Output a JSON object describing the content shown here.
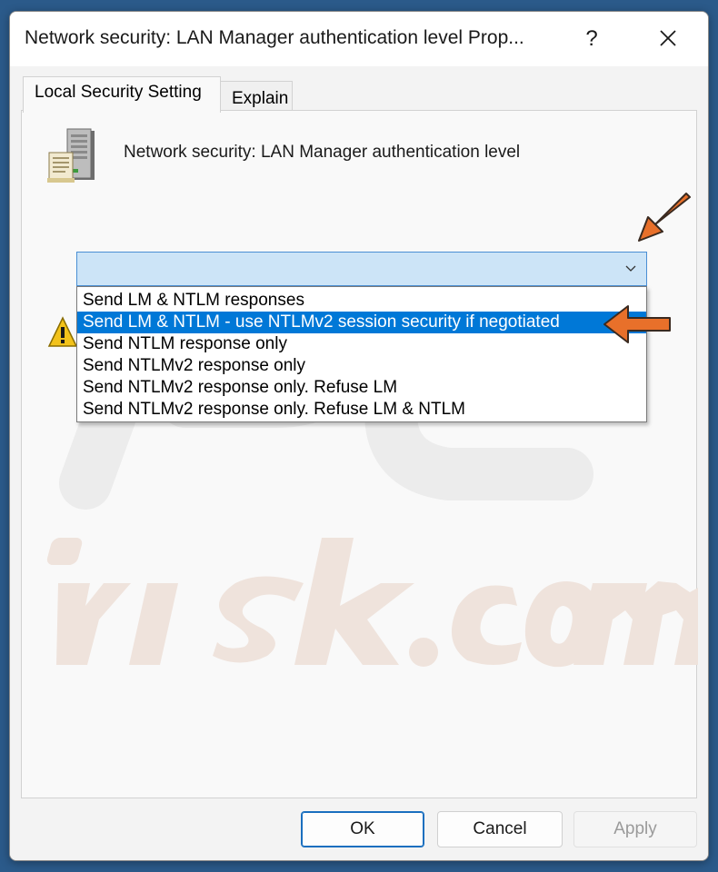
{
  "window": {
    "title": "Network security: LAN Manager authentication level Prop...",
    "help_label": "?",
    "close_icon": "close-icon"
  },
  "tabs": [
    {
      "label": "Local Security Setting",
      "active": true
    },
    {
      "label": "Explain",
      "active": false
    }
  ],
  "policy": {
    "name": "Network security: LAN Manager authentication level",
    "icon": "server-icon"
  },
  "combo": {
    "value": "",
    "icon": "chevron-down-icon",
    "options": [
      "Send LM & NTLM responses",
      "Send LM & NTLM - use NTLMv2 session security if negotiated",
      "Send NTLM response only",
      "Send NTLMv2 response only",
      "Send NTLMv2 response only. Refuse LM",
      "Send NTLMv2 response only. Refuse LM & NTLM"
    ],
    "highlighted_index": 1
  },
  "annotations": {
    "arrow_color": "#e8702a"
  },
  "buttons": {
    "ok": "OK",
    "cancel": "Cancel",
    "apply": "Apply"
  },
  "colors": {
    "selection": "#0078d7",
    "combo_bg": "#cce4f7",
    "combo_border": "#4a8fd4"
  }
}
